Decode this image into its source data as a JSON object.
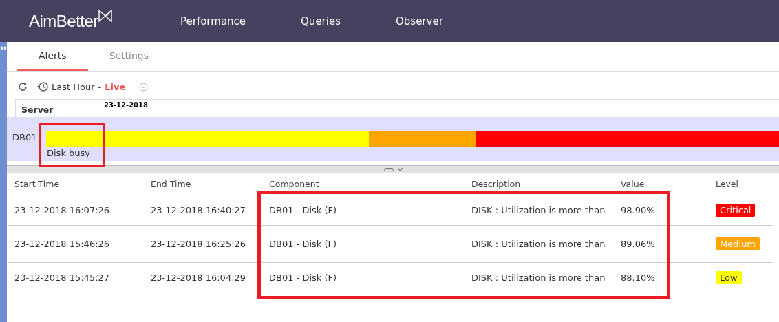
{
  "header": {
    "logo": "AimBetter",
    "nav": [
      {
        "label": "Performance",
        "selected": false
      },
      {
        "label": "Queries",
        "selected": false
      },
      {
        "label": "Observer",
        "selected": false
      }
    ]
  },
  "tabs": [
    {
      "label": "Alerts",
      "selected": true
    },
    {
      "label": "Settings",
      "selected": false
    }
  ],
  "toolbar": {
    "range": "Last Hour",
    "separator": "-",
    "live": "Live"
  },
  "timeline": {
    "column": "Server",
    "date": "23-12-2018",
    "server": "DB01",
    "event": "Disk busy",
    "segments": [
      {
        "color": "#ffff00"
      },
      {
        "color": "#ffa500"
      },
      {
        "color": "#ff0000"
      }
    ]
  },
  "table": {
    "columns": [
      "Start Time",
      "End Time",
      "Component",
      "Description",
      "Value",
      "Level"
    ],
    "rows": [
      {
        "start": "23-12-2018 16:07:26",
        "end": "23-12-2018 16:40:27",
        "component": "DB01 - Disk (F)",
        "description": "DISK : Utilization is more than",
        "value": "98.90%",
        "level_label": "Critical",
        "color": "#ff0000"
      },
      {
        "start": "23-12-2018 15:46:26",
        "end": "23-12-2018 16:25:26",
        "component": "DB01 - Disk (F)",
        "description": "DISK : Utilization is more than",
        "value": "89.06%",
        "level_label": "Medium",
        "color": "#ffa500"
      },
      {
        "start": "23-12-2018 15:45:27",
        "end": "23-12-2018 16:04:29",
        "component": "DB01 - Disk (F)",
        "description": "DISK : Utilization is more than",
        "value": "88.10%",
        "level_label": "Low",
        "color": "#ffff00"
      }
    ]
  }
}
